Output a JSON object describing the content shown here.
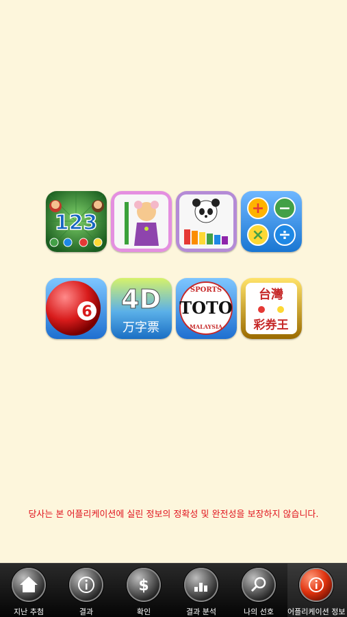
{
  "apps": [
    {
      "name": "123 Math Kids",
      "icon": "math-123-icon",
      "text": "123"
    },
    {
      "name": "Kids Draw",
      "icon": "girl-crayon-icon"
    },
    {
      "name": "Panda Xylophone",
      "icon": "panda-xylophone-icon"
    },
    {
      "name": "Calculator",
      "icon": "calculator-symbols-icon",
      "symbols": [
        "+",
        "−",
        "×",
        "÷"
      ]
    },
    {
      "name": "Lotto 6",
      "icon": "lotto-ball-icon",
      "text": "6"
    },
    {
      "name": "4D",
      "icon": "4d-icon",
      "text": "4D",
      "subtext": "万字票"
    },
    {
      "name": "Sports TOTO",
      "icon": "toto-icon",
      "text": "TOTO",
      "top_text": "SPORTS",
      "bottom_text": "MALAYSIA"
    },
    {
      "name": "Taiwan Lottery",
      "icon": "taiwan-lottery-icon",
      "text": "台灣",
      "subtext": "彩券王"
    }
  ],
  "disclaimer": "당사는 본 어플리케이션에 실린 정보의 정확성 및 완전성을 보장하지 않습니다.",
  "tabs": [
    {
      "label": "지난 추첨",
      "icon": "home-icon"
    },
    {
      "label": "결과",
      "icon": "info-icon"
    },
    {
      "label": "확인",
      "icon": "dollar-icon"
    },
    {
      "label": "결과 분석",
      "icon": "bar-chart-icon"
    },
    {
      "label": "나의 선호",
      "icon": "search-icon"
    },
    {
      "label": "어플리케이션 정보",
      "icon": "app-info-icon",
      "active": true
    }
  ],
  "colors": {
    "background": "#fdf6dc",
    "disclaimer": "#e0141e",
    "tabbar": "#111111",
    "active_tab_icon": "#e0320e"
  }
}
